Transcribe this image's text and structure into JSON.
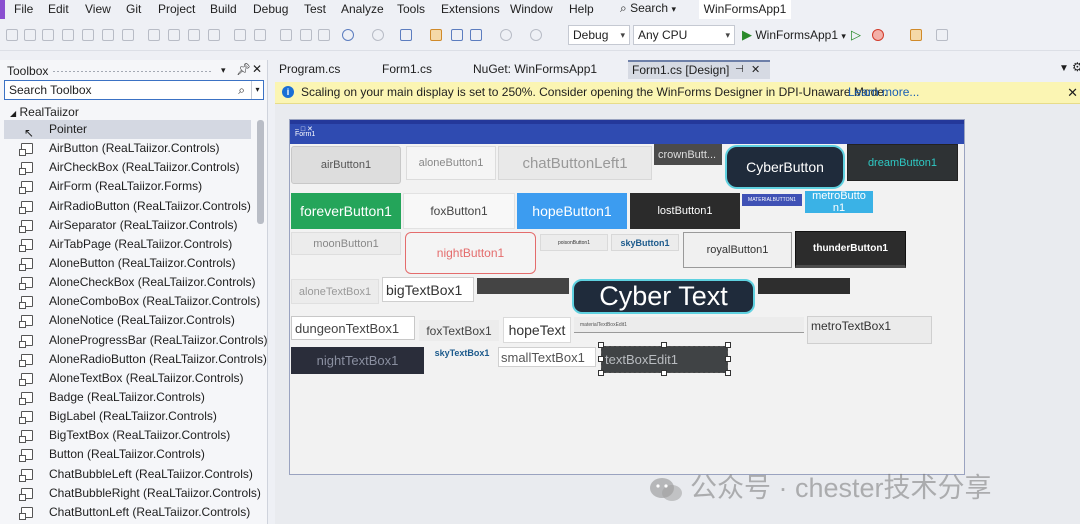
{
  "menu": {
    "items": [
      "File",
      "Edit",
      "View",
      "Git",
      "Project",
      "Build",
      "Debug",
      "Test",
      "Analyze",
      "Tools",
      "Extensions",
      "Window",
      "Help"
    ],
    "search_label": "Search",
    "project_name": "WinFormsApp1"
  },
  "toolbar": {
    "config": "Debug",
    "platform": "Any CPU",
    "run_label": "WinFormsApp1"
  },
  "toolbox": {
    "title": "Toolbox",
    "search_placeholder": "Search Toolbox",
    "group": "RealTaiizor",
    "items": [
      "Pointer",
      "AirButton (ReaLTaiizor.Controls)",
      "AirCheckBox (ReaLTaiizor.Controls)",
      "AirForm (ReaLTaiizor.Forms)",
      "AirRadioButton (ReaLTaiizor.Controls)",
      "AirSeparator (ReaLTaiizor.Controls)",
      "AirTabPage (ReaLTaiizor.Controls)",
      "AloneButton (ReaLTaiizor.Controls)",
      "AloneCheckBox (ReaLTaiizor.Controls)",
      "AloneComboBox (ReaLTaiizor.Controls)",
      "AloneNotice (ReaLTaiizor.Controls)",
      "AloneProgressBar (ReaLTaiizor.Controls)",
      "AloneRadioButton (ReaLTaiizor.Controls)",
      "AloneTextBox (ReaLTaiizor.Controls)",
      "Badge (ReaLTaiizor.Controls)",
      "BigLabel (ReaLTaiizor.Controls)",
      "BigTextBox (ReaLTaiizor.Controls)",
      "Button (ReaLTaiizor.Controls)",
      "ChatBubbleLeft (ReaLTaiizor.Controls)",
      "ChatBubbleRight (ReaLTaiizor.Controls)",
      "ChatButtonLeft (ReaLTaiizor.Controls)"
    ]
  },
  "tabs": [
    {
      "label": "Program.cs"
    },
    {
      "label": "Form1.cs"
    },
    {
      "label": "NuGet: WinFormsApp1"
    },
    {
      "label": "Form1.cs [Design]"
    }
  ],
  "infobar": {
    "message": "Scaling on your main display is set to 250%. Consider opening the WinForms Designer in DPI-Unaware Mode.",
    "link": "Learn more..."
  },
  "form": {
    "caption": "Form1",
    "controls": {
      "airButton1": "airButton1",
      "aloneButton1": "aloneButton1",
      "chatButtonLeft1": "chatButtonLeft1",
      "crownButton1": "crownButt...",
      "cyberButton": "CyberButton",
      "dreamButton1": "dreamButton1",
      "foreverButton1": "foreverButton1",
      "foxButton1": "foxButton1",
      "hopeButton1": "hopeButton1",
      "lostButton1": "lostButton1",
      "materialButton1": "MATERIALBUTTON1",
      "metroButton1": "metroButto n1",
      "moonButton1": "moonButton1",
      "nightButton1": "nightButton1",
      "poisonButton1": "poisonButton1",
      "skyButton1": "skyButton1",
      "royalButton1": "royalButton1",
      "thunderButton1": "thunderButton1",
      "aloneTextBox1": "aloneTextBox1",
      "bigTextBox1": "bigTextBox1",
      "cyberText": "Cyber Text",
      "dungeonTextBox1": "dungeonTextBox1",
      "foxTextBox1": "foxTextBox1",
      "hopeText": "hopeText",
      "materialTextBoxEdit1": "materialTextBoxEdit1",
      "metroTextBox1": "metroTextBox1",
      "nightTextBox1": "nightTextBox1",
      "skyTextBox1": "skyTextBox1",
      "smallTextBox1": "smallTextBox1",
      "textBoxEdit1": "textBoxEdit1"
    }
  },
  "watermark": "公众号 · chester技术分享",
  "colors": {
    "accent": "#2f4bb1",
    "infobar": "#fbf5b3",
    "forever": "#24a55a",
    "hope": "#3c9cf0",
    "cyber": "#1f2b3b",
    "dream": "#2e3234"
  }
}
